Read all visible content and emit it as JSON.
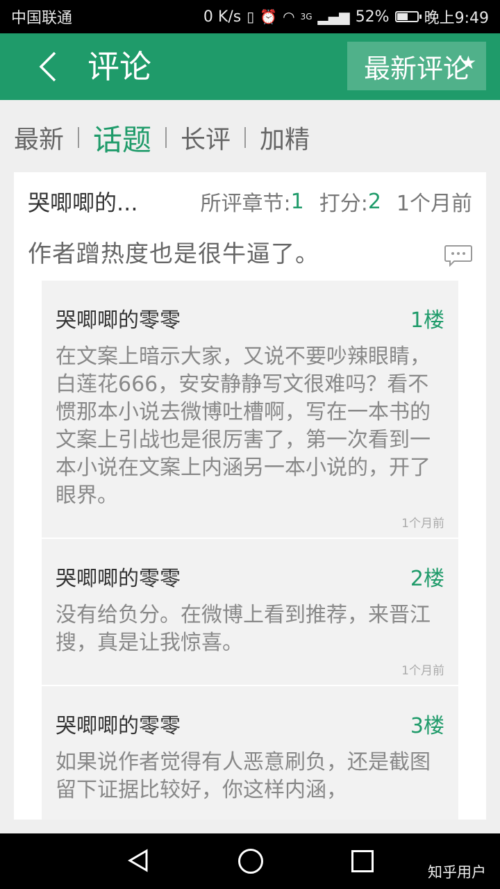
{
  "status_bar": {
    "carrier": "中国联通",
    "speed": "0 K/s",
    "network": "3G",
    "battery": "52%",
    "battery_level": 0.52,
    "time": "晚上9:49"
  },
  "header": {
    "title": "评论",
    "right_button": "最新评论"
  },
  "tabs": [
    {
      "label": "最新"
    },
    {
      "label": "话题"
    },
    {
      "label": "长评"
    },
    {
      "label": "加精"
    }
  ],
  "active_tab": "话题",
  "comment": {
    "author": "哭唧唧的...",
    "chapter_label": "所评章节:",
    "chapter_value": "1",
    "score_label": "打分:",
    "score_value": "2",
    "time": "1个月前",
    "text": "作者蹭热度也是很牛逼了。"
  },
  "replies": [
    {
      "author": "哭唧唧的零零",
      "floor": "1楼",
      "body": "在文案上暗示大家，又说不要吵辣眼睛，白莲花666，安安静静写文很难吗？看不惯那本小说去微博吐槽啊，写在一本书的文案上引战也是很厉害了，第一次看到一本小说在文案上内涵另一本小说的，开了眼界。",
      "time": "1个月前"
    },
    {
      "author": "哭唧唧的零零",
      "floor": "2楼",
      "body": "没有给负分。在微博上看到推荐，来晋江搜，真是让我惊喜。",
      "time": "1个月前"
    },
    {
      "author": "哭唧唧的零零",
      "floor": "3楼",
      "body": "如果说作者觉得有人恶意刷负，还是截图留下证据比较好，你这样内涵，",
      "time": ""
    }
  ],
  "watermark": "知乎用户",
  "colors": {
    "brand": "#1f9b6a",
    "background": "#efefef"
  }
}
